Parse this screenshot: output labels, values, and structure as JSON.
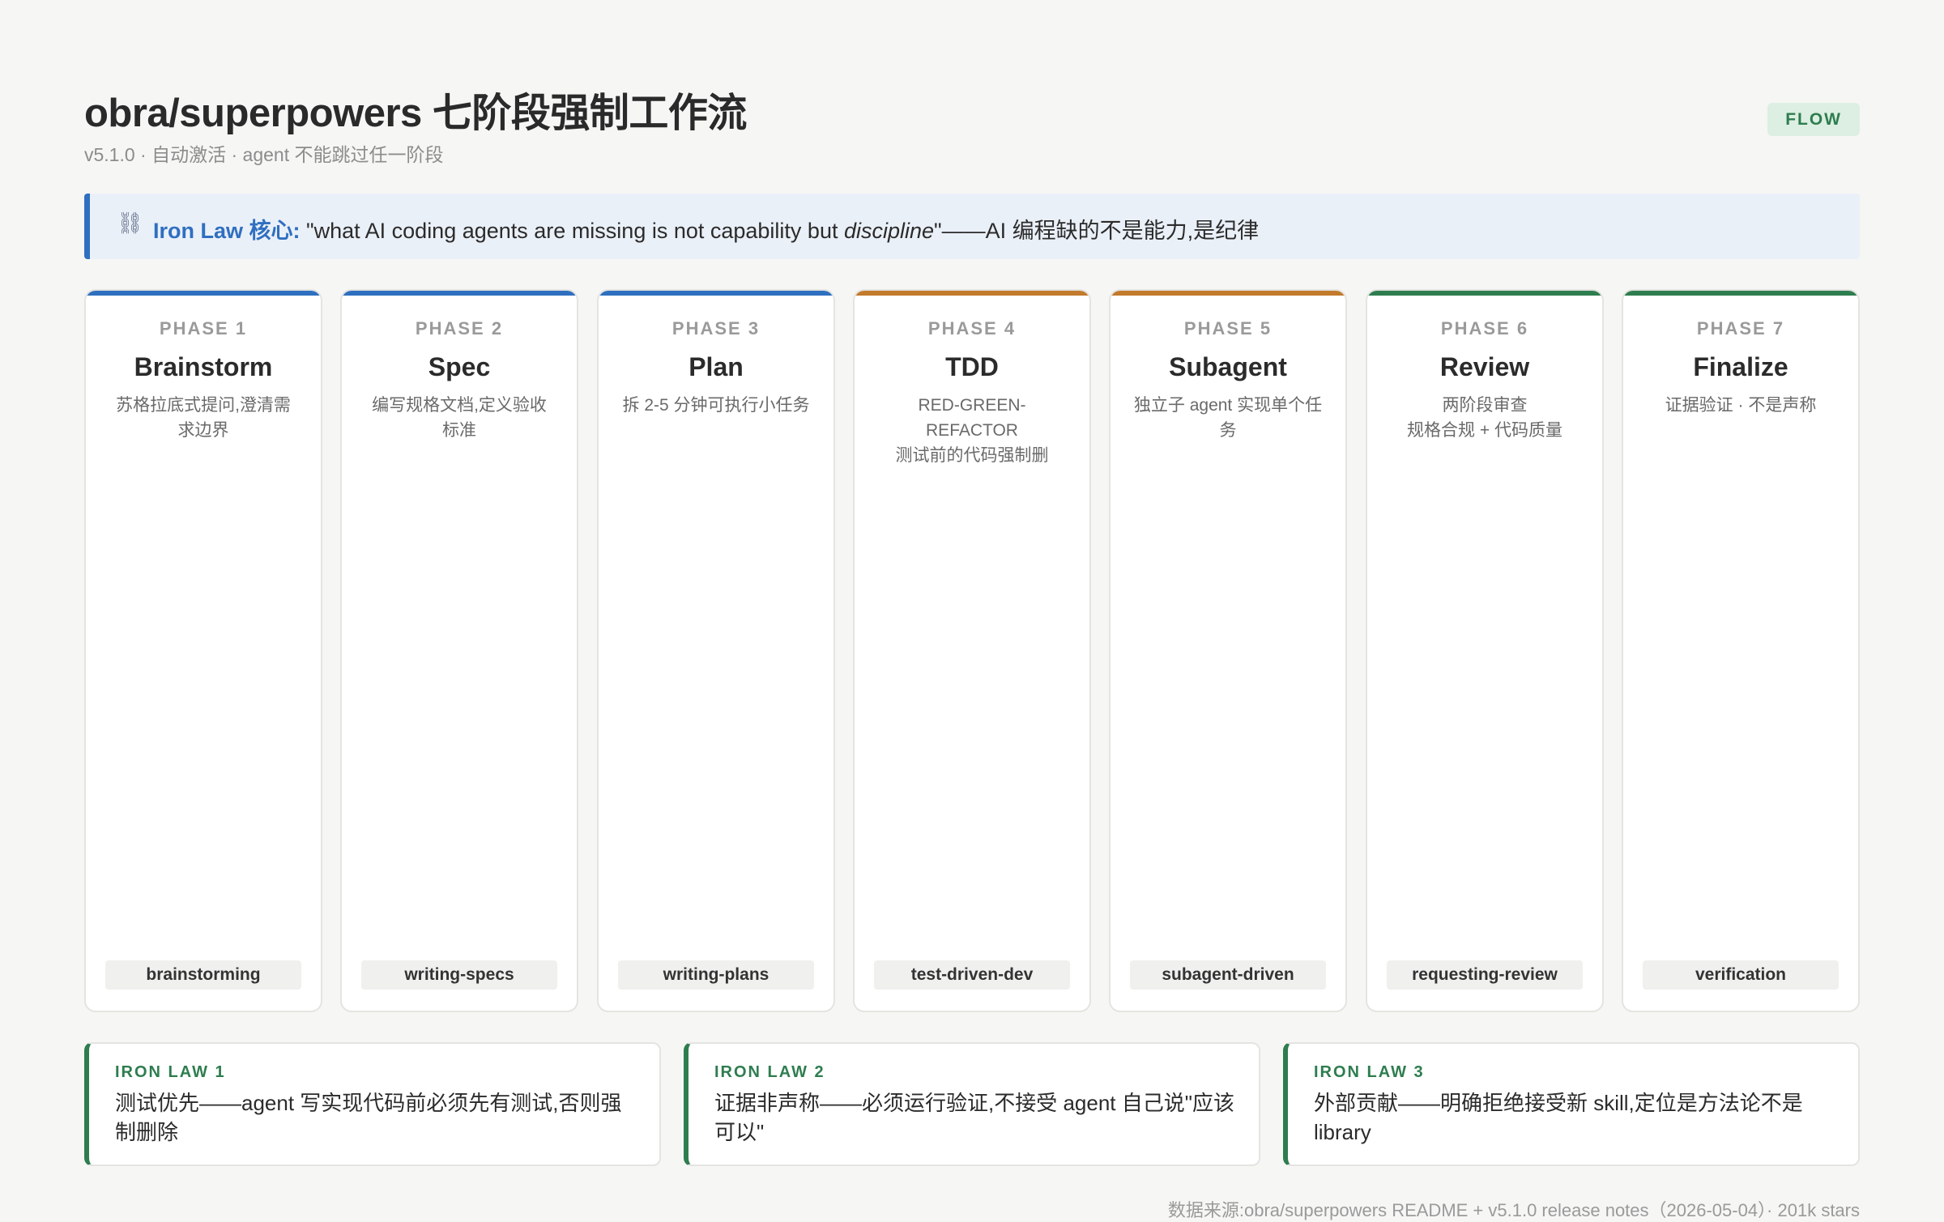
{
  "header": {
    "title": "obra/superpowers 七阶段强制工作流",
    "subtitle": "v5.1.0 · 自动激活 · agent 不能跳过任一阶段",
    "badge": "FLOW"
  },
  "callout": {
    "icon": "chain-link-icon",
    "label": "Iron Law 核心:",
    "quote_before": "\"what AI coding agents are missing is not capability but ",
    "quote_emphasis": "discipline",
    "quote_after": "\"——AI 编程缺的不是能力,是纪律"
  },
  "colors": {
    "blue": "#2f6fc0",
    "orange": "#c27a2c",
    "green": "#2e7d4f"
  },
  "phases": [
    {
      "num": "PHASE 1",
      "name": "Brainstorm",
      "desc": "苏格拉底式提问,澄清需求边界",
      "skill": "brainstorming",
      "accent": "#2f6fc0"
    },
    {
      "num": "PHASE 2",
      "name": "Spec",
      "desc": "编写规格文档,定义验收标准",
      "skill": "writing-specs",
      "accent": "#2f6fc0"
    },
    {
      "num": "PHASE 3",
      "name": "Plan",
      "desc": "拆 2-5 分钟可执行小任务",
      "skill": "writing-plans",
      "accent": "#2f6fc0"
    },
    {
      "num": "PHASE 4",
      "name": "TDD",
      "desc": "RED-GREEN-REFACTOR\n测试前的代码强制删",
      "skill": "test-driven-dev",
      "accent": "#c27a2c"
    },
    {
      "num": "PHASE 5",
      "name": "Subagent",
      "desc": "独立子 agent 实现单个任务",
      "skill": "subagent-driven",
      "accent": "#c27a2c"
    },
    {
      "num": "PHASE 6",
      "name": "Review",
      "desc": "两阶段审查\n规格合规 + 代码质量",
      "skill": "requesting-review",
      "accent": "#2e7d4f"
    },
    {
      "num": "PHASE 7",
      "name": "Finalize",
      "desc": "证据验证 · 不是声称",
      "skill": "verification",
      "accent": "#2e7d4f"
    }
  ],
  "laws": [
    {
      "title": "IRON LAW 1",
      "text": "测试优先——agent 写实现代码前必须先有测试,否则强制删除"
    },
    {
      "title": "IRON LAW 2",
      "text": "证据非声称——必须运行验证,不接受 agent 自己说\"应该可以\""
    },
    {
      "title": "IRON LAW 3",
      "text": "外部贡献——明确拒绝接受新 skill,定位是方法论不是 library"
    }
  ],
  "footer": "数据来源:obra/superpowers README + v5.1.0 release notes（2026-05-04）· 201k stars"
}
